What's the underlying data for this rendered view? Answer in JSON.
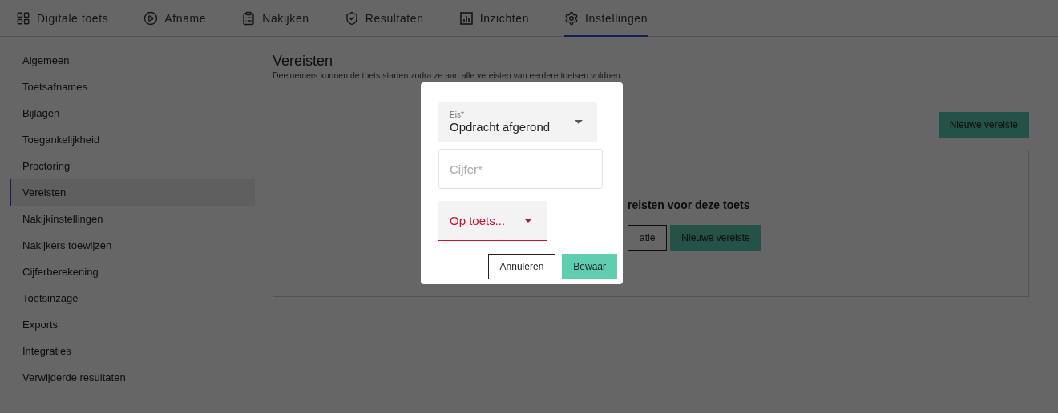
{
  "tabs": [
    {
      "label": "Digitale toets",
      "selected": false
    },
    {
      "label": "Afname",
      "selected": false
    },
    {
      "label": "Nakijken",
      "selected": false
    },
    {
      "label": "Resultaten",
      "selected": false
    },
    {
      "label": "Inzichten",
      "selected": false
    },
    {
      "label": "Instellingen",
      "selected": true
    }
  ],
  "sidebar": {
    "items": [
      {
        "label": "Algemeen",
        "selected": false
      },
      {
        "label": "Toetsafnames",
        "selected": false
      },
      {
        "label": "Bijlagen",
        "selected": false
      },
      {
        "label": "Toegankelijkheid",
        "selected": false
      },
      {
        "label": "Proctoring",
        "selected": false
      },
      {
        "label": "Vereisten",
        "selected": true
      },
      {
        "label": "Nakijkinstellingen",
        "selected": false
      },
      {
        "label": "Nakijkers toewijzen",
        "selected": false
      },
      {
        "label": "Cijferberekening",
        "selected": false
      },
      {
        "label": "Toetsinzage",
        "selected": false
      },
      {
        "label": "Exports",
        "selected": false
      },
      {
        "label": "Integraties",
        "selected": false
      },
      {
        "label": "Verwijderde resultaten",
        "selected": false
      }
    ]
  },
  "main": {
    "title": "Vereisten",
    "description": "Deelnemers kunnen de toets starten zodra ze aan alle vereisten van eerdere toetsen voldoen.",
    "new_button": "Nieuwe vereiste",
    "empty_state": {
      "message": "reisten voor deze toets",
      "buttons": [
        {
          "label": "atie",
          "kind": "outline"
        },
        {
          "label": "Nieuwe vereiste",
          "kind": "primary"
        }
      ]
    }
  },
  "dialog": {
    "requirement_select": {
      "label": "Eis*",
      "value": "Opdracht afgerond",
      "invalid": false
    },
    "grade_field": {
      "placeholder": "Cijfer*"
    },
    "test_select": {
      "placeholder": "Op toets...",
      "invalid": true
    },
    "buttons": [
      {
        "label": "Annuleren",
        "kind": "outline"
      },
      {
        "label": "Bewaar",
        "kind": "primary"
      }
    ]
  }
}
